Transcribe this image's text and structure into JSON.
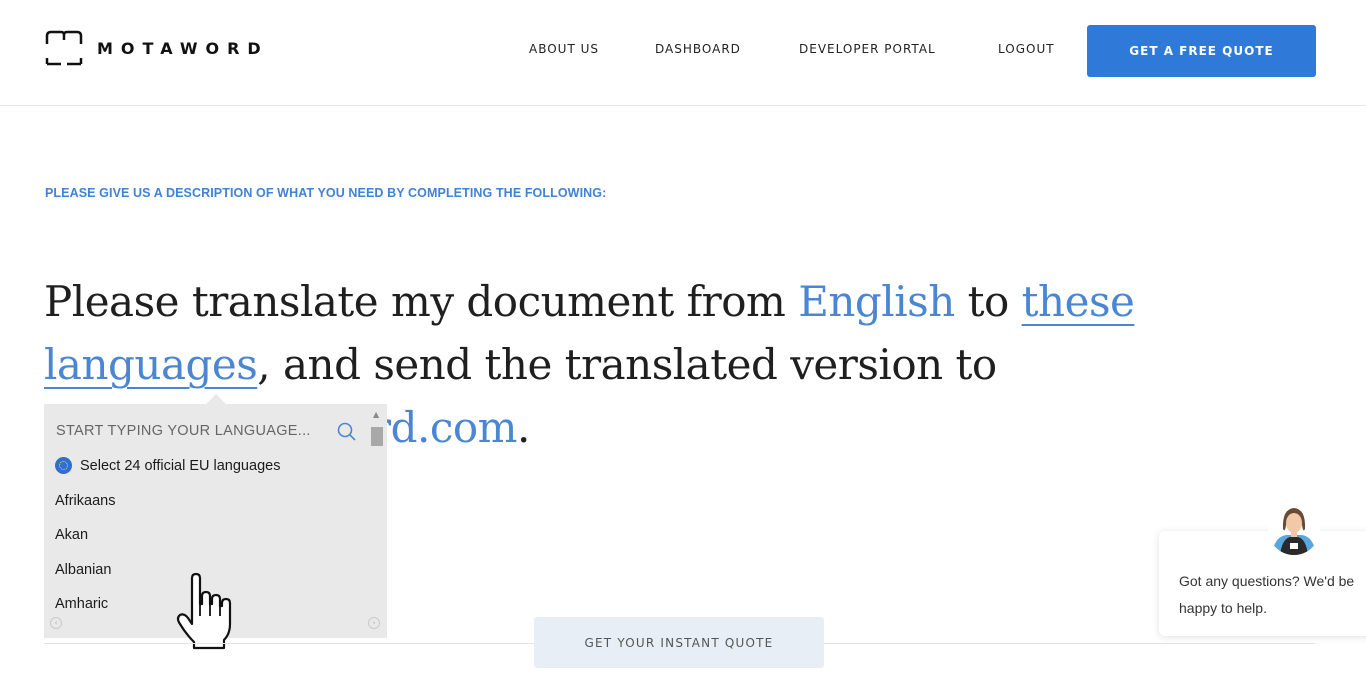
{
  "brand": {
    "name": "MOTAWORD",
    "logo_icon": "book-icon"
  },
  "nav": {
    "about": "ABOUT US",
    "dashboard": "DASHBOARD",
    "developer": "DEVELOPER PORTAL",
    "logout": "LOGOUT",
    "cta": "GET A FREE QUOTE"
  },
  "intro": "PLEASE GIVE US A DESCRIPTION OF WHAT YOU NEED BY COMPLETING THE FOLLOWING:",
  "headline": {
    "part1": "Please translate my document from ",
    "source_language": "English",
    "part2": " to ",
    "target_link": "these languages",
    "part3": ", and send the translated version to",
    "email_tail": "rd.com",
    "part4": "."
  },
  "dropdown": {
    "placeholder": "START TYPING YOUR LANGUAGE...",
    "search_icon": "search-icon",
    "eu_option": "Select 24 official EU languages",
    "options": [
      "Afrikaans",
      "Akan",
      "Albanian",
      "Amharic"
    ]
  },
  "instant_quote_button": "GET YOUR INSTANT QUOTE",
  "chat": {
    "message_line1": "Got any questions? We'd be",
    "message_line2": "happy to help."
  },
  "colors": {
    "accent": "#2f7ad8",
    "link": "#4b86d2",
    "intro_text": "#3f82d6",
    "dropdown_bg": "#e9e9e9"
  }
}
